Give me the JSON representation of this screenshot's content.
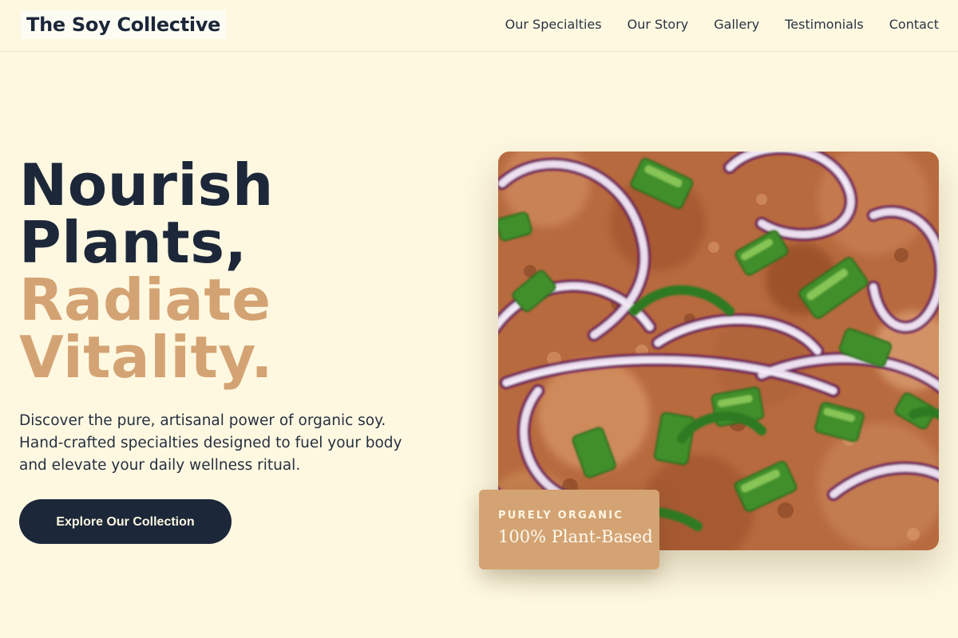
{
  "brand": {
    "name": "The Soy Collective"
  },
  "nav": {
    "items": [
      {
        "label": "Our Specialties"
      },
      {
        "label": "Our Story"
      },
      {
        "label": "Gallery"
      },
      {
        "label": "Testimonials"
      },
      {
        "label": "Contact"
      }
    ]
  },
  "hero": {
    "headline_dark_1": "Nourish",
    "headline_dark_2": "Plants,",
    "headline_accent_1": "Radiate",
    "headline_accent_2": "Vitality.",
    "tagline": "Discover the pure, artisanal power of organic soy. Hand-crafted specialties designed to fuel your body and elevate your daily wellness ritual.",
    "cta_label": "Explore Our Collection",
    "image_alt": "Soy dish with red onion and green scallions",
    "badge": {
      "eyebrow": "PURELY ORGANIC",
      "title": "100% Plant-Based"
    }
  },
  "colors": {
    "background": "#fef8e1",
    "navy": "#1c2739",
    "accent": "#d4a373"
  }
}
